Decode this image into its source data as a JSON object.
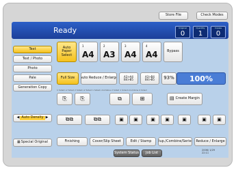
{
  "top_buttons": {
    "store_file": "Store File",
    "check_modes": "Check Modes"
  },
  "status": {
    "ready": "Ready",
    "counters": [
      {
        "label": "Original",
        "value": "0"
      },
      {
        "label": "Quantity",
        "value": "1"
      },
      {
        "label": "Copies",
        "value": "0"
      }
    ]
  },
  "left_modes": [
    "Text",
    "Text / Photo",
    "Photo",
    "Pale",
    "Generation Copy"
  ],
  "auto_density": "Auto Density",
  "special_original": "Special Original",
  "paper": {
    "auto_paper": "Auto Paper Select",
    "trays": [
      {
        "num": "1",
        "size": "A4"
      },
      {
        "num": "2",
        "size": "A3"
      },
      {
        "num": "3",
        "size": "A4"
      },
      {
        "num": "4",
        "size": "A4"
      }
    ],
    "bypass": "Bypass"
  },
  "reduce_row": {
    "full_size": "Full Size",
    "auto_reduce": "Auto Reduce / Enlarge",
    "r1": "A3>A4 B4>B5",
    "r2": "A3>B4 B4>B5",
    "pct_small": "93%",
    "pct_big": "100%"
  },
  "duplex": {
    "labels": "1 Sided>2 Sided   2 Sided>2 Sided   1 Sided>Combine 2 Sided   1 Sided>Combine 4 Sided",
    "create_margin": "Create Margin"
  },
  "bottom_tabs": [
    "Finishing",
    "Cover/Slip Sheet",
    "Edit / Stamp",
    "Dup./Combine/Series",
    "Reduce / Enlarge"
  ],
  "footer": {
    "system_status": "System Status",
    "job_list": "Job List",
    "datetime": "2006/ 1/29\n22:11"
  }
}
